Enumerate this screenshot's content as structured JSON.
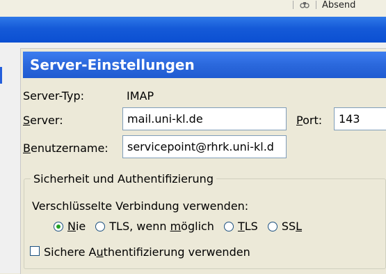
{
  "top_fragment": {
    "icon": "address-book-icon",
    "text": "Absend"
  },
  "header": {
    "title": "Server-Einstellungen"
  },
  "server": {
    "type_label": "Server-Typ:",
    "type_value": "IMAP",
    "server_label_underlined": "S",
    "server_label_rest": "erver:",
    "server_value": "mail.uni-kl.de",
    "port_label_underlined": "P",
    "port_label_rest": "ort:",
    "port_value": "143",
    "user_label_underlined": "B",
    "user_label_rest": "enutzername:",
    "user_value": "servicepoint@rhrk.uni-kl.d"
  },
  "security": {
    "group_title": "Sicherheit und Authentifizierung",
    "encryption_label": "Verschlüsselte Verbindung verwenden:",
    "options": [
      {
        "pre": "",
        "ul": "N",
        "post": "ie",
        "selected": true
      },
      {
        "pre": "TLS, wenn ",
        "ul": "m",
        "post": "öglich",
        "selected": false
      },
      {
        "pre": "",
        "ul": "T",
        "post": "LS",
        "selected": false
      },
      {
        "pre": "SS",
        "ul": "L",
        "post": "",
        "selected": false
      }
    ],
    "secure_auth_pre": "Sichere A",
    "secure_auth_ul": "u",
    "secure_auth_post": "thentifizierung verwenden",
    "secure_auth_checked": false
  },
  "colors": {
    "header_blue": "#2b68dc",
    "radio_selected": "#21a121"
  }
}
